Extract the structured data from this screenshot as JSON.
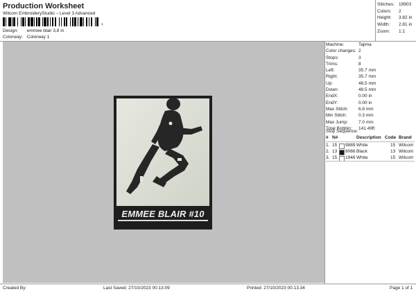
{
  "header": {
    "title": "Production Worksheet",
    "subtitle": "Wilcom EmbroideryStudio – Level 3 Advanced",
    "barcode_suffix": ","
  },
  "design_info": {
    "design_label": "Design:",
    "design_value": "emmee blair 3,8 in",
    "colorway_label": "Colorway:",
    "colorway_value": "Colorway 1"
  },
  "top_stats": [
    {
      "label": "Stitches:",
      "value": "19903"
    },
    {
      "label": "Colors:",
      "value": "2"
    },
    {
      "label": "Height:",
      "value": "3.82 in"
    },
    {
      "label": "Width:",
      "value": "2.81 in"
    },
    {
      "label": "Zoom:",
      "value": "1:1"
    }
  ],
  "design_preview": {
    "text": "EMMEE BLAIR #10",
    "colors": {
      "border": "#1e1e1e",
      "background": "#d9dcd2",
      "figure": "#2a2a2a",
      "text": "#f0f0f0"
    }
  },
  "machine_info": [
    {
      "label": "Machine:",
      "value": "Tajima"
    },
    {
      "label": "Color changes:",
      "value": "2"
    },
    {
      "label": "Stops:",
      "value": "3"
    },
    {
      "label": "Trims:",
      "value": "8"
    },
    {
      "label": "Left:",
      "value": "35.7 mm"
    },
    {
      "label": "Right:",
      "value": "35.7 mm"
    },
    {
      "label": "Up:",
      "value": "48.5 mm"
    },
    {
      "label": "Down:",
      "value": "48.5 mm"
    },
    {
      "label": "EndX:",
      "value": "0.00 in"
    },
    {
      "label": "EndY:",
      "value": "0.00 in"
    },
    {
      "label": "Max Stitch:",
      "value": "6.8 mm"
    },
    {
      "label": "Min Stitch:",
      "value": "0.3 mm"
    },
    {
      "label": "Max Jump:",
      "value": "7.0 mm"
    },
    {
      "label": "Total Bobbin:",
      "value": "141.49ft"
    }
  ],
  "stop_sequence": {
    "title": "Stop Sequence:",
    "headers": {
      "num": "#",
      "n": "N#",
      "description": "Description",
      "code": "Code",
      "brand": "Brand"
    },
    "rows": [
      {
        "num": "1.",
        "n": "15",
        "swatch": "#ffffff",
        "color_code": "9889",
        "description": "White",
        "code": "15",
        "brand": "Wilcom"
      },
      {
        "num": "2.",
        "n": "13",
        "swatch": "#1a1a1a",
        "color_code": "8066",
        "description": "Black",
        "code": "13",
        "brand": "Wilcom"
      },
      {
        "num": "3.",
        "n": "15",
        "swatch": "#ffffff",
        "color_code": "1946",
        "description": "White",
        "code": "15",
        "brand": "Wilcom"
      }
    ]
  },
  "footer": {
    "created_by": "Created By:",
    "last_saved": "Last Saved: 27/10/2023 00.13.09",
    "printed": "Printed: 27/10/2023 00.13.34",
    "page": "Page 1 of 1"
  }
}
